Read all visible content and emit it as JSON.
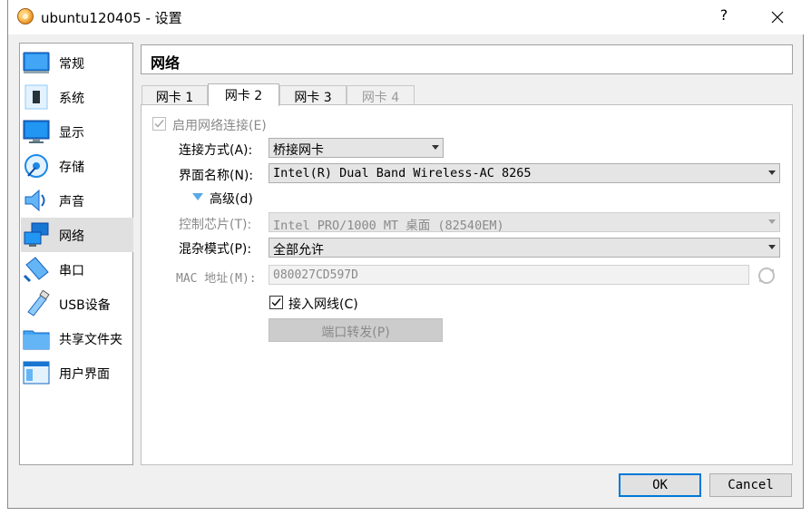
{
  "window": {
    "title": "ubuntu120405 - 设置",
    "help_label": "?"
  },
  "sidebar": {
    "items": [
      {
        "label": "常规",
        "icon": "general-icon"
      },
      {
        "label": "系统",
        "icon": "system-icon"
      },
      {
        "label": "显示",
        "icon": "display-icon"
      },
      {
        "label": "存储",
        "icon": "storage-icon"
      },
      {
        "label": "声音",
        "icon": "audio-icon"
      },
      {
        "label": "网络",
        "icon": "network-icon",
        "selected": true
      },
      {
        "label": "串口",
        "icon": "serial-port-icon"
      },
      {
        "label": "USB设备",
        "icon": "usb-icon"
      },
      {
        "label": "共享文件夹",
        "icon": "shared-folder-icon"
      },
      {
        "label": "用户界面",
        "icon": "user-interface-icon"
      }
    ]
  },
  "content": {
    "title": "网络",
    "tabs": [
      {
        "label": "网卡 1"
      },
      {
        "label": "网卡 2",
        "active": true
      },
      {
        "label": "网卡 3"
      },
      {
        "label": "网卡 4",
        "disabled": true
      }
    ],
    "enable_adapter": {
      "label": "启用网络连接(E)",
      "checked": true,
      "disabled": true
    },
    "attached_to": {
      "label": "连接方式(A):",
      "value": "桥接网卡"
    },
    "name": {
      "label": "界面名称(N):",
      "value": "Intel(R) Dual Band Wireless-AC 8265"
    },
    "advanced": {
      "label": "高级(d)"
    },
    "adapter_type": {
      "label": "控制芯片(T):",
      "value": "Intel PRO/1000 MT 桌面 (82540EM)"
    },
    "promiscuous": {
      "label": "混杂模式(P):",
      "value": "全部允许"
    },
    "mac": {
      "label": "MAC 地址(M):",
      "value": "080027CD597D"
    },
    "cable": {
      "label": "接入网线(C)",
      "checked": true
    },
    "port_forwarding": {
      "label": "端口转发(P)"
    }
  },
  "footer": {
    "ok_label": "OK",
    "cancel_label": "Cancel"
  },
  "colors": {
    "accent": "#0078d7",
    "selected_bg": "#e0e0e0",
    "window_bg": "#f0f0f0"
  }
}
